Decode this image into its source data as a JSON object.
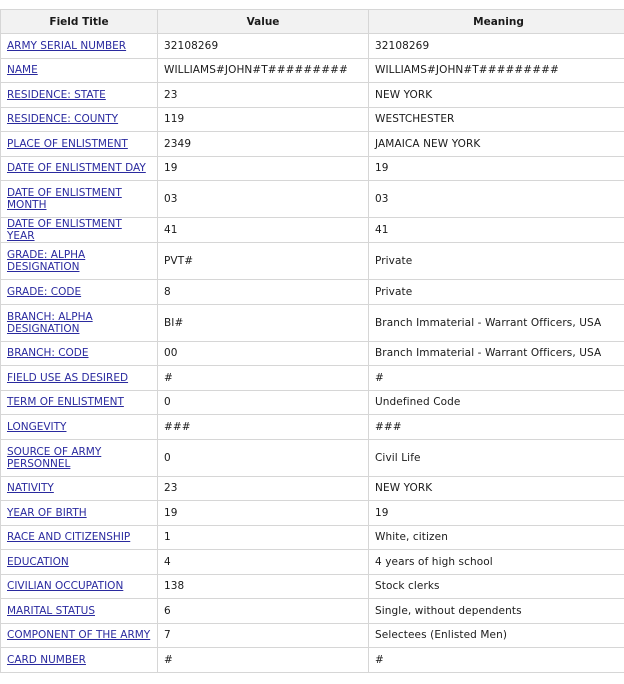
{
  "headers": [
    "Field Title",
    "Value",
    "Meaning"
  ],
  "rows": [
    {
      "field": "ARMY SERIAL NUMBER",
      "value": "32108269",
      "meaning": "32108269",
      "tall": false
    },
    {
      "field": "NAME",
      "value": "WILLIAMS#JOHN#T#########",
      "meaning": "WILLIAMS#JOHN#T#########",
      "tall": false
    },
    {
      "field": "RESIDENCE: STATE",
      "value": "23",
      "meaning": "NEW YORK",
      "tall": false
    },
    {
      "field": "RESIDENCE: COUNTY",
      "value": "119",
      "meaning": "WESTCHESTER",
      "tall": false
    },
    {
      "field": "PLACE OF ENLISTMENT",
      "value": "2349",
      "meaning": "JAMAICA NEW YORK",
      "tall": false
    },
    {
      "field": "DATE OF ENLISTMENT DAY",
      "value": "19",
      "meaning": "19",
      "tall": false
    },
    {
      "field": "DATE OF ENLISTMENT MONTH",
      "value": "03",
      "meaning": "03",
      "tall": true
    },
    {
      "field": "DATE OF ENLISTMENT YEAR",
      "value": "41",
      "meaning": "41",
      "tall": false
    },
    {
      "field": "GRADE: ALPHA DESIGNATION",
      "value": "PVT#",
      "meaning": "Private",
      "tall": true
    },
    {
      "field": "GRADE: CODE",
      "value": "8",
      "meaning": "Private",
      "tall": false
    },
    {
      "field": "BRANCH: ALPHA DESIGNATION",
      "value": "BI#",
      "meaning": "Branch Immaterial - Warrant Officers, USA",
      "tall": true
    },
    {
      "field": "BRANCH: CODE",
      "value": "00",
      "meaning": "Branch Immaterial - Warrant Officers, USA",
      "tall": false
    },
    {
      "field": "FIELD USE AS DESIRED",
      "value": "#",
      "meaning": "#",
      "tall": false
    },
    {
      "field": "TERM OF ENLISTMENT",
      "value": "0",
      "meaning": "Undefined Code",
      "tall": false
    },
    {
      "field": "LONGEVITY",
      "value": "###",
      "meaning": "###",
      "tall": false
    },
    {
      "field": "SOURCE OF ARMY PERSONNEL",
      "value": "0",
      "meaning": "Civil Life",
      "tall": true
    },
    {
      "field": "NATIVITY",
      "value": "23",
      "meaning": "NEW YORK",
      "tall": false
    },
    {
      "field": "YEAR OF BIRTH",
      "value": "19",
      "meaning": "19",
      "tall": false
    },
    {
      "field": "RACE AND CITIZENSHIP",
      "value": "1",
      "meaning": "White, citizen",
      "tall": false
    },
    {
      "field": "EDUCATION",
      "value": "4",
      "meaning": "4 years of high school",
      "tall": false
    },
    {
      "field": "CIVILIAN OCCUPATION",
      "value": "138",
      "meaning": "Stock clerks",
      "tall": false
    },
    {
      "field": "MARITAL STATUS",
      "value": "6",
      "meaning": "Single, without dependents",
      "tall": false
    },
    {
      "field": "COMPONENT OF THE ARMY",
      "value": "7",
      "meaning": "Selectees (Enlisted Men)",
      "tall": false
    },
    {
      "field": "CARD NUMBER",
      "value": "#",
      "meaning": "#",
      "tall": false
    }
  ]
}
